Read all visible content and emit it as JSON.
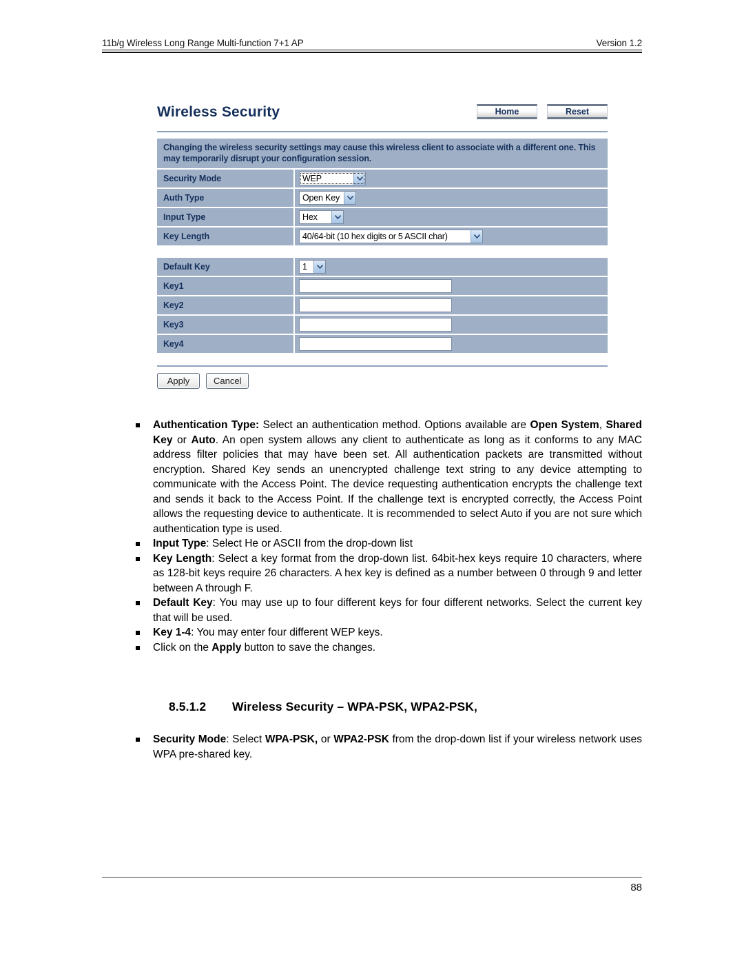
{
  "header": {
    "left": "11b/g Wireless Long Range Multi-function 7+1 AP",
    "right": "Version 1.2"
  },
  "ui": {
    "title": "Wireless Security",
    "buttons": {
      "home": "Home",
      "reset": "Reset"
    },
    "notice": "Changing the wireless security settings may cause this wireless client to associate with a different one. This may temporarily disrupt your configuration session.",
    "rows": [
      {
        "label": "Security Mode",
        "value": "WEP"
      },
      {
        "label": "Auth Type",
        "value": "Open Key"
      },
      {
        "label": "Input Type",
        "value": "Hex"
      },
      {
        "label": "Key Length",
        "value": "40/64-bit (10 hex digits or 5 ASCII char)"
      }
    ],
    "key_rows": [
      {
        "label": "Default Key",
        "value": "1"
      },
      {
        "label": "Key1",
        "value": ""
      },
      {
        "label": "Key2",
        "value": ""
      },
      {
        "label": "Key3",
        "value": ""
      },
      {
        "label": "Key4",
        "value": ""
      }
    ],
    "actions": {
      "apply": "Apply",
      "cancel": "Cancel"
    },
    "colors": {
      "row_bg": "#9fb0c6",
      "label_text": "#16305c",
      "title_text": "#16305c",
      "rule": "#8fa2bd",
      "select_arrow": "#a8c6e6"
    }
  },
  "body": {
    "bullet1": {
      "term": "Authentication Type:",
      "text_a": " Select an authentication method. Options available are ",
      "b1": "Open System",
      "text_b": ", ",
      "b2": "Shared Key",
      "text_c": " or ",
      "b3": "Auto",
      "text_d": ". An open system allows any client to authenticate as long as it conforms to any MAC address filter policies that may have been set. All authentication packets are transmitted without encryption. Shared Key sends an unencrypted challenge text string to any device attempting to communicate with the Access Point. The device requesting authentication encrypts the challenge text and sends it back to the Access Point. If the challenge text is encrypted correctly, the Access Point allows the requesting device to authenticate. It is recommended to select Auto if you are not sure which authentication type is used."
    },
    "bullet2": {
      "term": "Input Type",
      "text": ": Select He or ASCII from the drop-down list"
    },
    "bullet3": {
      "term": "Key Length",
      "text": ": Select a key format from the drop-down list. 64bit-hex keys require 10 characters, where as 128-bit keys require 26 characters. A hex key is defined as a number between 0 through 9 and letter between A through F."
    },
    "bullet4": {
      "term": "Default Key",
      "text": ": You may use up to four different keys for four different networks. Select the current key that will be used."
    },
    "bullet5": {
      "term": "Key 1-4",
      "text": ": You may enter four different WEP keys."
    },
    "bullet6": {
      "text_a": "Click on the ",
      "term": "Apply",
      "text_b": " button to save the changes."
    }
  },
  "section": {
    "number": "8.5.1.2",
    "title": "Wireless Security – WPA-PSK, WPA2-PSK,"
  },
  "body2": {
    "bullet1": {
      "term": "Security Mode",
      "text_a": ": Select ",
      "b1": "WPA-PSK,",
      "text_b": " or ",
      "b2": "WPA2-PSK",
      "text_c": " from the drop-down list if your wireless network uses WPA pre-shared key."
    }
  },
  "footer": {
    "page_number": "88"
  }
}
